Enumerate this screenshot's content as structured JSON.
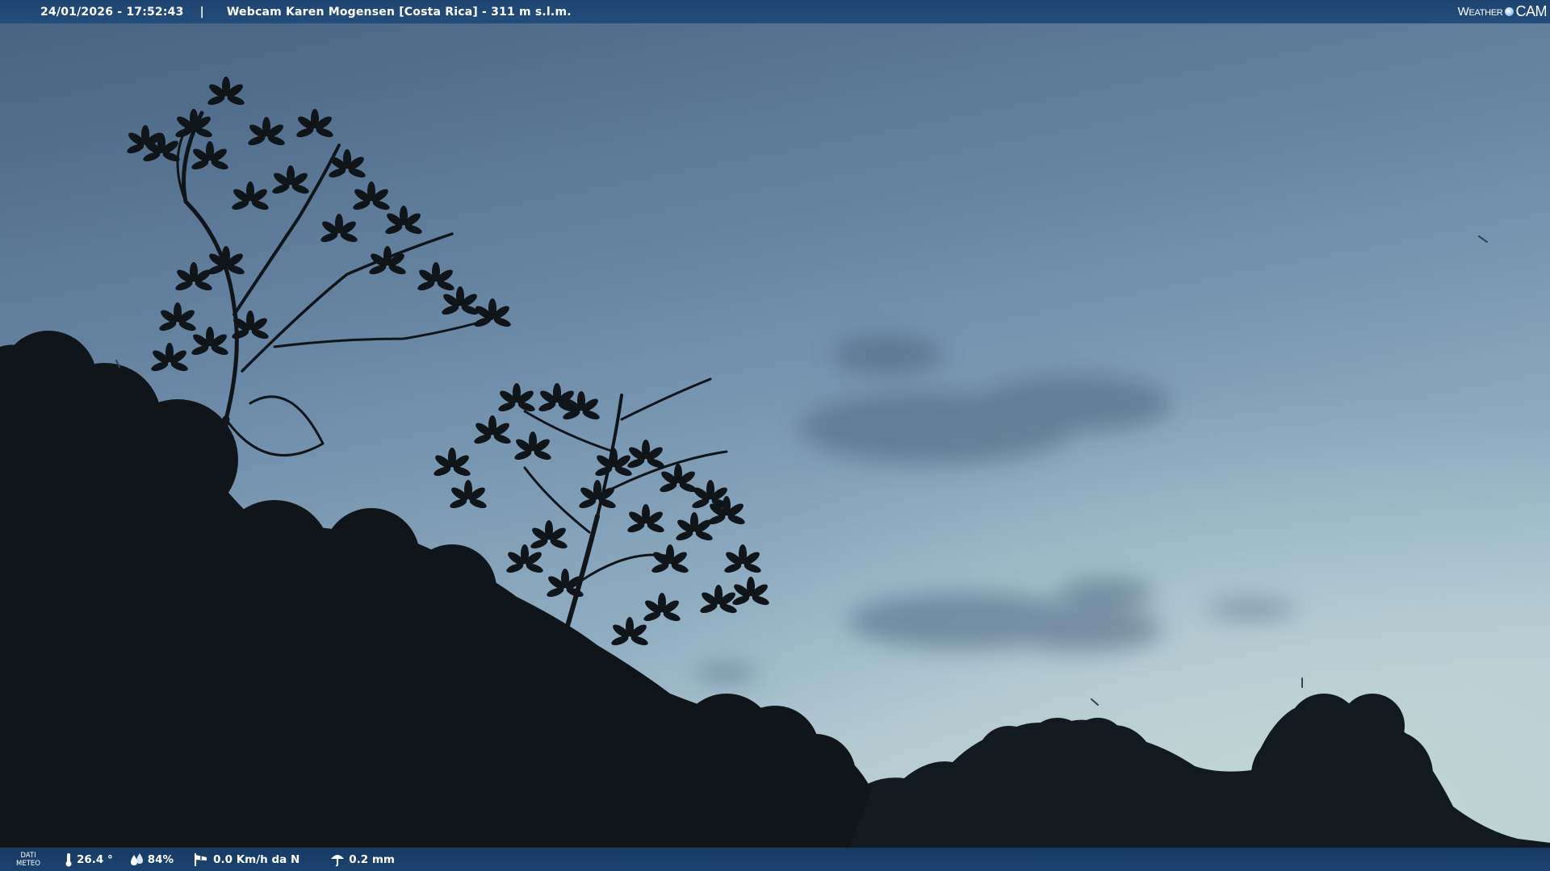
{
  "header": {
    "timestamp": "24/01/2026 - 17:52:43",
    "separator": "|",
    "title": "Webcam Karen Mogensen [Costa Rica] - 311 m s.l.m."
  },
  "brand": {
    "word": "Weather",
    "cam": "CAM"
  },
  "weather": {
    "label_line1": "DATI",
    "label_line2": "METEO",
    "temperature": "26.4 °",
    "humidity": "84%",
    "wind": "0.0 Km/h da N",
    "rain": "0.2 mm"
  },
  "colors": {
    "bar": "#1f4470",
    "sky_top": "#4a6788",
    "sky_bottom": "#a9c2cf",
    "foliage": "#10161a"
  }
}
